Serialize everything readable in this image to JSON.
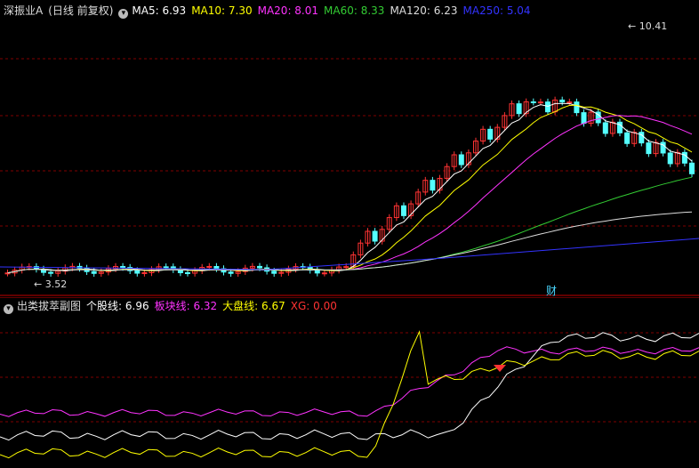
{
  "main": {
    "stock_name": "深振业A",
    "period": "(日线 前复权)",
    "ma": [
      {
        "label": "MA5: ",
        "value": "6.93",
        "color": "#ffffff"
      },
      {
        "label": "MA10: ",
        "value": "7.30",
        "color": "#ffff00"
      },
      {
        "label": "MA20: ",
        "value": "8.01",
        "color": "#ff33ff"
      },
      {
        "label": "MA60: ",
        "value": "8.33",
        "color": "#33cc33"
      },
      {
        "label": "MA120: ",
        "value": "6.23",
        "color": "#dddddd"
      },
      {
        "label": "MA250: ",
        "value": "5.04",
        "color": "#3333ff"
      }
    ],
    "high_label": "10.41",
    "low_label": "3.52",
    "cai_label": "财"
  },
  "sub": {
    "name": "出类拔萃副图",
    "lines": [
      {
        "label": "个股线: ",
        "value": "6.96",
        "color": "#ffffff"
      },
      {
        "label": "板块线: ",
        "value": "6.32",
        "color": "#ff33ff"
      },
      {
        "label": "大盘线: ",
        "value": "6.67",
        "color": "#ffff00"
      },
      {
        "label": "XG: ",
        "value": "0.00",
        "color": "#ff3333"
      }
    ]
  },
  "colors": {
    "up": "#ff3333",
    "down": "#54ffff",
    "grid": "#800000",
    "bg": "#000000"
  }
}
